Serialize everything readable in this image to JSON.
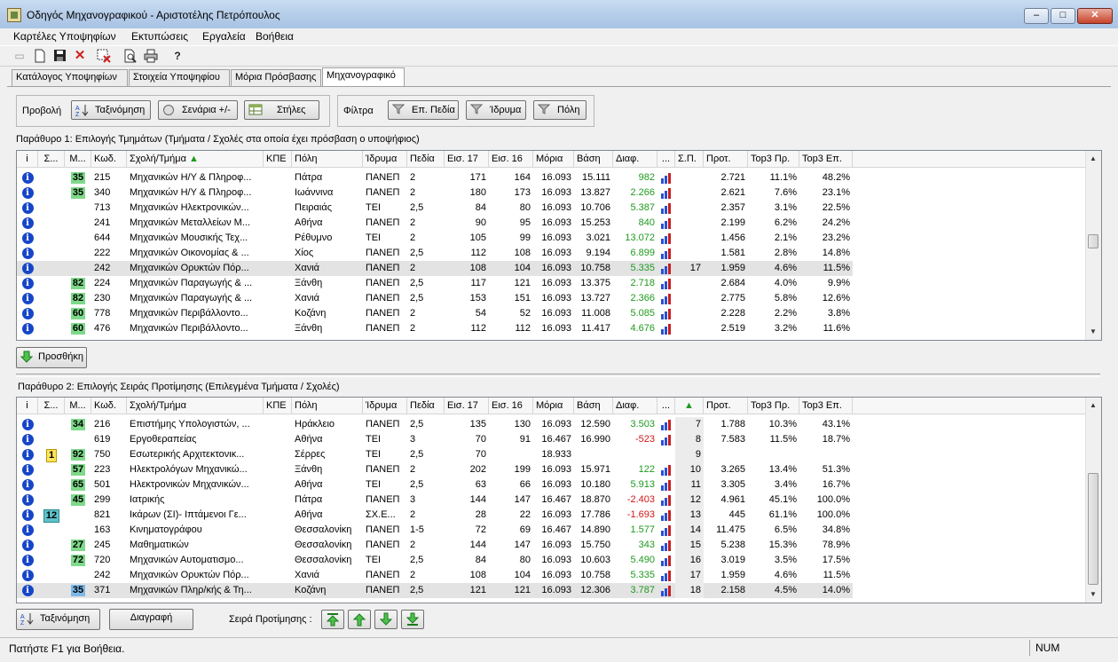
{
  "window": {
    "title": "Οδηγός Μηχανογραφικού - Αριστοτέλης Πετρόπουλος",
    "minimize": "–",
    "maximize": "□",
    "close": "✕"
  },
  "menu": [
    "Καρτέλες Υποψηφίων",
    "Εκτυπώσεις",
    "Εργαλεία",
    "Βοήθεια"
  ],
  "toolbar_icons": [
    "open-folder-icon",
    "new-document-icon",
    "save-icon",
    "delete-icon",
    "clear-selection-icon",
    "print-preview-icon",
    "print-icon",
    "help-icon"
  ],
  "tabs": [
    "Κατάλογος Υποψηφίων",
    "Στοιχεία Υποψηφίου",
    "Μόρια Πρόσβασης",
    "Μηχανογραφικό"
  ],
  "active_tab": "Μηχανογραφικό",
  "view": {
    "label": "Προβολή",
    "sort_button": "Ταξινόμηση",
    "scenarios_button": "Σενάρια +/-",
    "columns_button": "Στήλες"
  },
  "filters": {
    "label": "Φίλτρα",
    "fields_button": "Επ. Πεδία",
    "institution_button": "Ίδρυμα",
    "city_button": "Πόλη"
  },
  "panel1": {
    "title": "Παράθυρο 1: Επιλογής Τμημάτων (Τμήματα / Σχολές στα οποία έχει πρόσβαση ο υποψήφιος)",
    "headers": [
      "i",
      "Σ...",
      "Μ...",
      "Κωδ.",
      "Σχολή/Τμήμα",
      "ΚΠΕ",
      "Πόλη",
      "Ίδρυμα",
      "Πεδία",
      "Εισ. 17",
      "Εισ. 16",
      "Μόρια",
      "Βάση",
      "Διαφ.",
      "...",
      "Σ.Π.",
      "Προτ.",
      "Top3 Πρ.",
      "Top3 Επ."
    ],
    "rows": [
      {
        "m": "35",
        "code": "215",
        "school": "Μηχανικών Η/Υ & Πληροφ...",
        "city": "Πάτρα",
        "inst": "ΠΑΝΕΠ",
        "fields": "2",
        "e17": "171",
        "e16": "164",
        "moria": "16.093",
        "vasi": "15.111",
        "diaf": "982",
        "sp": "",
        "prot": "2.721",
        "t3p": "11.1%",
        "t3e": "48.2%"
      },
      {
        "m": "35",
        "code": "340",
        "school": "Μηχανικών Η/Υ & Πληροφ...",
        "city": "Ιωάννινα",
        "inst": "ΠΑΝΕΠ",
        "fields": "2",
        "e17": "180",
        "e16": "173",
        "moria": "16.093",
        "vasi": "13.827",
        "diaf": "2.266",
        "sp": "",
        "prot": "2.621",
        "t3p": "7.6%",
        "t3e": "23.1%"
      },
      {
        "m": "",
        "code": "713",
        "school": "Μηχανικών Ηλεκτρονικών...",
        "city": "Πειραιάς",
        "inst": "ΤΕΙ",
        "fields": "2,5",
        "e17": "84",
        "e16": "80",
        "moria": "16.093",
        "vasi": "10.706",
        "diaf": "5.387",
        "sp": "",
        "prot": "2.357",
        "t3p": "3.1%",
        "t3e": "22.5%"
      },
      {
        "m": "",
        "code": "241",
        "school": "Μηχανικών Μεταλλείων Μ...",
        "city": "Αθήνα",
        "inst": "ΠΑΝΕΠ",
        "fields": "2",
        "e17": "90",
        "e16": "95",
        "moria": "16.093",
        "vasi": "15.253",
        "diaf": "840",
        "sp": "",
        "prot": "2.199",
        "t3p": "6.2%",
        "t3e": "24.2%"
      },
      {
        "m": "",
        "code": "644",
        "school": "Μηχανικών Μουσικής Τεχ...",
        "city": "Ρέθυμνο",
        "inst": "ΤΕΙ",
        "fields": "2",
        "e17": "105",
        "e16": "99",
        "moria": "16.093",
        "vasi": "3.021",
        "diaf": "13.072",
        "sp": "",
        "prot": "1.456",
        "t3p": "2.1%",
        "t3e": "23.2%"
      },
      {
        "m": "",
        "code": "222",
        "school": "Μηχανικών Οικονομίας & ...",
        "city": "Χίος",
        "inst": "ΠΑΝΕΠ",
        "fields": "2,5",
        "e17": "112",
        "e16": "108",
        "moria": "16.093",
        "vasi": "9.194",
        "diaf": "6.899",
        "sp": "",
        "prot": "1.581",
        "t3p": "2.8%",
        "t3e": "14.8%"
      },
      {
        "m": "",
        "code": "242",
        "school": "Μηχανικών Ορυκτών Πόρ...",
        "city": "Χανιά",
        "inst": "ΠΑΝΕΠ",
        "fields": "2",
        "e17": "108",
        "e16": "104",
        "moria": "16.093",
        "vasi": "10.758",
        "diaf": "5.335",
        "sp": "17",
        "prot": "1.959",
        "t3p": "4.6%",
        "t3e": "11.5%"
      },
      {
        "m": "82",
        "code": "224",
        "school": "Μηχανικών Παραγωγής & ...",
        "city": "Ξάνθη",
        "inst": "ΠΑΝΕΠ",
        "fields": "2,5",
        "e17": "117",
        "e16": "121",
        "moria": "16.093",
        "vasi": "13.375",
        "diaf": "2.718",
        "sp": "",
        "prot": "2.684",
        "t3p": "4.0%",
        "t3e": "9.9%"
      },
      {
        "m": "82",
        "code": "230",
        "school": "Μηχανικών Παραγωγής & ...",
        "city": "Χανιά",
        "inst": "ΠΑΝΕΠ",
        "fields": "2,5",
        "e17": "153",
        "e16": "151",
        "moria": "16.093",
        "vasi": "13.727",
        "diaf": "2.366",
        "sp": "",
        "prot": "2.775",
        "t3p": "5.8%",
        "t3e": "12.6%"
      },
      {
        "m": "60",
        "code": "778",
        "school": "Μηχανικών Περιβάλλοντο...",
        "city": "Κοζάνη",
        "inst": "ΠΑΝΕΠ",
        "fields": "2",
        "e17": "54",
        "e16": "52",
        "moria": "16.093",
        "vasi": "11.008",
        "diaf": "5.085",
        "sp": "",
        "prot": "2.228",
        "t3p": "2.2%",
        "t3e": "3.8%"
      },
      {
        "m": "60",
        "code": "476",
        "school": "Μηχανικών Περιβάλλοντο...",
        "city": "Ξάνθη",
        "inst": "ΠΑΝΕΠ",
        "fields": "2",
        "e17": "112",
        "e16": "112",
        "moria": "16.093",
        "vasi": "11.417",
        "diaf": "4.676",
        "sp": "",
        "prot": "2.519",
        "t3p": "3.2%",
        "t3e": "11.6%"
      }
    ]
  },
  "add_button": "Προσθήκη",
  "panel2": {
    "title": "Παράθυρο 2: Επιλογής Σειράς Προτίμησης (Επιλεγμένα Τμήματα / Σχολές)",
    "headers": [
      "i",
      "Σ...",
      "Μ...",
      "Κωδ.",
      "Σχολή/Τμήμα",
      "ΚΠΕ",
      "Πόλη",
      "Ίδρυμα",
      "Πεδία",
      "Εισ. 17",
      "Εισ. 16",
      "Μόρια",
      "Βάση",
      "Διαφ.",
      "...",
      "▲",
      "Προτ.",
      "Top3 Πρ.",
      "Top3 Επ."
    ],
    "rows": [
      {
        "s": "",
        "m": "34",
        "code": "216",
        "school": "Επιστήμης Υπολογιστών, ...",
        "city": "Ηράκλειο",
        "inst": "ΠΑΝΕΠ",
        "fields": "2,5",
        "e17": "135",
        "e16": "130",
        "moria": "16.093",
        "vasi": "12.590",
        "diaf": "3.503",
        "sp": "7",
        "prot": "1.788",
        "t3p": "10.3%",
        "t3e": "43.1%"
      },
      {
        "s": "",
        "m": "",
        "code": "619",
        "school": "Εργοθεραπείας",
        "city": "Αθήνα",
        "inst": "ΤΕΙ",
        "fields": "3",
        "e17": "70",
        "e16": "91",
        "moria": "16.467",
        "vasi": "16.990",
        "diaf": "-523",
        "sp": "8",
        "prot": "7.583",
        "t3p": "11.5%",
        "t3e": "18.7%"
      },
      {
        "s": "1",
        "m": "92",
        "code": "750",
        "school": "Εσωτερικής Αρχιτεκτονικ...",
        "city": "Σέρρες",
        "inst": "ΤΕΙ",
        "fields": "2,5",
        "e17": "70",
        "e16": "",
        "moria": "18.933",
        "vasi": "",
        "diaf": "",
        "sp": "9",
        "prot": "",
        "t3p": "",
        "t3e": ""
      },
      {
        "s": "",
        "m": "57",
        "code": "223",
        "school": "Ηλεκτρολόγων Μηχανικώ...",
        "city": "Ξάνθη",
        "inst": "ΠΑΝΕΠ",
        "fields": "2",
        "e17": "202",
        "e16": "199",
        "moria": "16.093",
        "vasi": "15.971",
        "diaf": "122",
        "sp": "10",
        "prot": "3.265",
        "t3p": "13.4%",
        "t3e": "51.3%"
      },
      {
        "s": "",
        "m": "65",
        "code": "501",
        "school": "Ηλεκτρονικών Μηχανικών...",
        "city": "Αθήνα",
        "inst": "ΤΕΙ",
        "fields": "2,5",
        "e17": "63",
        "e16": "66",
        "moria": "16.093",
        "vasi": "10.180",
        "diaf": "5.913",
        "sp": "11",
        "prot": "3.305",
        "t3p": "3.4%",
        "t3e": "16.7%"
      },
      {
        "s": "",
        "m": "45",
        "code": "299",
        "school": "Ιατρικής",
        "city": "Πάτρα",
        "inst": "ΠΑΝΕΠ",
        "fields": "3",
        "e17": "144",
        "e16": "147",
        "moria": "16.467",
        "vasi": "18.870",
        "diaf": "-2.403",
        "sp": "12",
        "prot": "4.961",
        "t3p": "45.1%",
        "t3e": "100.0%"
      },
      {
        "s": "12",
        "m": "",
        "code": "821",
        "school": "Ικάρων (ΣΙ)- Ιπτάμενοι Γε...",
        "city": "Αθήνα",
        "inst": "ΣΧ.Ε...",
        "fields": "2",
        "e17": "28",
        "e16": "22",
        "moria": "16.093",
        "vasi": "17.786",
        "diaf": "-1.693",
        "sp": "13",
        "prot": "445",
        "t3p": "61.1%",
        "t3e": "100.0%"
      },
      {
        "s": "",
        "m": "",
        "code": "163",
        "school": "Κινηματογράφου",
        "city": "Θεσσαλονίκη",
        "inst": "ΠΑΝΕΠ",
        "fields": "1-5",
        "e17": "72",
        "e16": "69",
        "moria": "16.467",
        "vasi": "14.890",
        "diaf": "1.577",
        "sp": "14",
        "prot": "11.475",
        "t3p": "6.5%",
        "t3e": "34.8%"
      },
      {
        "s": "",
        "m": "27",
        "code": "245",
        "school": "Μαθηματικών",
        "city": "Θεσσαλονίκη",
        "inst": "ΠΑΝΕΠ",
        "fields": "2",
        "e17": "144",
        "e16": "147",
        "moria": "16.093",
        "vasi": "15.750",
        "diaf": "343",
        "sp": "15",
        "prot": "5.238",
        "t3p": "15.3%",
        "t3e": "78.9%"
      },
      {
        "s": "",
        "m": "72",
        "code": "720",
        "school": "Μηχανικών Αυτοματισμο...",
        "city": "Θεσσαλονίκη",
        "inst": "ΤΕΙ",
        "fields": "2,5",
        "e17": "84",
        "e16": "80",
        "moria": "16.093",
        "vasi": "10.603",
        "diaf": "5.490",
        "sp": "16",
        "prot": "3.019",
        "t3p": "3.5%",
        "t3e": "17.5%"
      },
      {
        "s": "",
        "m": "",
        "code": "242",
        "school": "Μηχανικών Ορυκτών Πόρ...",
        "city": "Χανιά",
        "inst": "ΠΑΝΕΠ",
        "fields": "2",
        "e17": "108",
        "e16": "104",
        "moria": "16.093",
        "vasi": "10.758",
        "diaf": "5.335",
        "sp": "17",
        "prot": "1.959",
        "t3p": "4.6%",
        "t3e": "11.5%"
      },
      {
        "s": "",
        "m": "35",
        "code": "371",
        "school": "Μηχανικών Πληρ/κής & Τη...",
        "city": "Κοζάνη",
        "inst": "ΠΑΝΕΠ",
        "fields": "2,5",
        "e17": "121",
        "e16": "121",
        "moria": "16.093",
        "vasi": "12.306",
        "diaf": "3.787",
        "sp": "18",
        "prot": "2.158",
        "t3p": "4.5%",
        "t3e": "14.0%"
      }
    ]
  },
  "bottom": {
    "sort_button": "Ταξινόμηση",
    "delete_button": "Διαγραφή",
    "order_label": "Σειρά Προτίμησης :"
  },
  "status": {
    "text": "Πατήστε F1 για Βοήθεια.",
    "num": "NUM"
  }
}
